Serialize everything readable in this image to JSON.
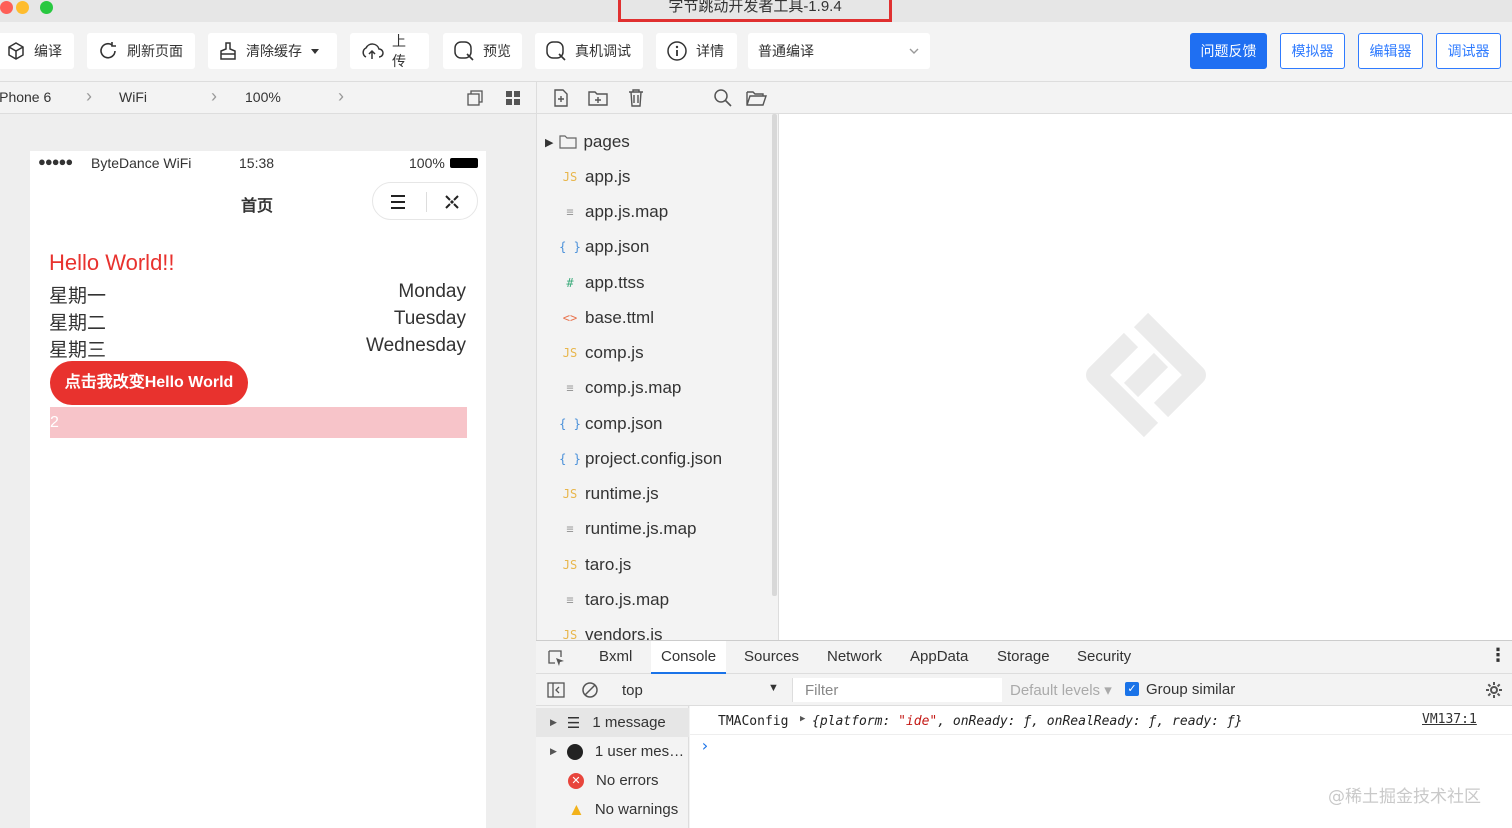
{
  "window": {
    "title": "字节跳动开发者工具-1.9.4"
  },
  "toolbar": {
    "compile": "编译",
    "refresh": "刷新页面",
    "clear_cache": "清除缓存",
    "upload": "上传",
    "preview": "预览",
    "device_debug": "真机调试",
    "details": "详情",
    "compile_mode": "普通编译",
    "feedback": "问题反馈",
    "simulator": "模拟器",
    "editor": "编辑器",
    "debugger": "调试器",
    "accent": "#1f6ff2"
  },
  "simbar": {
    "device": "iPhone 6",
    "network": "WiFi",
    "zoom": "100%"
  },
  "phone": {
    "carrier": "ByteDance WiFi",
    "signal": "●●●●●",
    "time": "15:38",
    "battery": "100%",
    "nav_title": "首页",
    "hello": "Hello World!!",
    "rows": [
      {
        "cn": "星期一",
        "en": "Monday"
      },
      {
        "cn": "星期二",
        "en": "Tuesday"
      },
      {
        "cn": "星期三",
        "en": "Wednesday"
      }
    ],
    "button": "点击我改变Hello World",
    "bar_value": "2",
    "hello_color": "#e8322e",
    "button_color": "#e8322e"
  },
  "files": [
    {
      "name": "pages",
      "icon": "folder-icon",
      "glyph": "▢",
      "folder": true
    },
    {
      "name": "app.js",
      "icon": "js-file-icon",
      "glyph": "JS"
    },
    {
      "name": "app.js.map",
      "icon": "map-file-icon",
      "glyph": "≡"
    },
    {
      "name": "app.json",
      "icon": "json-file-icon",
      "glyph": "{ }"
    },
    {
      "name": "app.ttss",
      "icon": "style-file-icon",
      "glyph": "#"
    },
    {
      "name": "base.ttml",
      "icon": "markup-file-icon",
      "glyph": "<>"
    },
    {
      "name": "comp.js",
      "icon": "js-file-icon",
      "glyph": "JS"
    },
    {
      "name": "comp.js.map",
      "icon": "map-file-icon",
      "glyph": "≡"
    },
    {
      "name": "comp.json",
      "icon": "json-file-icon",
      "glyph": "{ }"
    },
    {
      "name": "project.config.json",
      "icon": "json-file-icon",
      "glyph": "{ }"
    },
    {
      "name": "runtime.js",
      "icon": "js-file-icon",
      "glyph": "JS"
    },
    {
      "name": "runtime.js.map",
      "icon": "map-file-icon",
      "glyph": "≡"
    },
    {
      "name": "taro.js",
      "icon": "js-file-icon",
      "glyph": "JS"
    },
    {
      "name": "taro.js.map",
      "icon": "map-file-icon",
      "glyph": "≡"
    },
    {
      "name": "vendors.js",
      "icon": "js-file-icon",
      "glyph": "JS"
    }
  ],
  "devtools": {
    "tabs": [
      "Bxml",
      "Console",
      "Sources",
      "Network",
      "AppData",
      "Storage",
      "Security"
    ],
    "active_tab": "Console",
    "context": "top",
    "filter_placeholder": "Filter",
    "levels": "Default levels ▾",
    "group_similar": "Group similar",
    "side": [
      "1 message",
      "1 user mes…",
      "No errors",
      "No warnings"
    ],
    "log_label": "TMAConfig",
    "log_source": "VM137:1",
    "prompt": "›"
  },
  "watermark": "@稀土掘金技术社区"
}
